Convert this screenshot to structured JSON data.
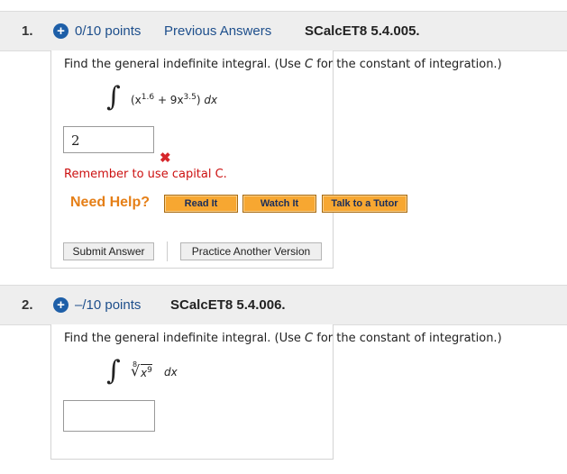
{
  "q1": {
    "number": "1.",
    "plus": "+",
    "points": "0/10 points",
    "previous_answers": "Previous Answers",
    "code": "SCalcET8 5.4.005.",
    "prompt_a": "Find the general indefinite integral. (Use ",
    "prompt_c": "C",
    "prompt_b": " for the constant of integration.)",
    "integral_sign": "∫",
    "expr_open": "(x",
    "expr_exp1": "1.6",
    "expr_mid": " + 9x",
    "expr_exp2": "3.5",
    "expr_close": ") ",
    "expr_dx": "dx",
    "answer_value": "2",
    "wrong_mark": "✖",
    "feedback": "Remember to use capital C.",
    "need_help": "Need Help?",
    "read_it": "Read It",
    "watch_it": "Watch It",
    "talk_tutor": "Talk to a Tutor",
    "submit": "Submit Answer",
    "practice": "Practice Another Version"
  },
  "q2": {
    "number": "2.",
    "plus": "+",
    "points": "–/10 points",
    "code": "SCalcET8 5.4.006.",
    "prompt_a": "Find the general indefinite integral. (Use ",
    "prompt_c": "C",
    "prompt_b": " for the constant of integration.)",
    "integral_sign": "∫",
    "root_index": "8",
    "radical": "√",
    "radicand_base": "x",
    "radicand_exp": "9",
    "expr_dx": "dx",
    "answer_value": ""
  },
  "colors": {
    "header_bg": "#eeeeee",
    "link_blue": "#1e4f8c",
    "plus_blue": "#1e5fa8",
    "help_orange": "#e57f17",
    "button_orange": "#f7a731",
    "error_red": "#cc1111"
  }
}
